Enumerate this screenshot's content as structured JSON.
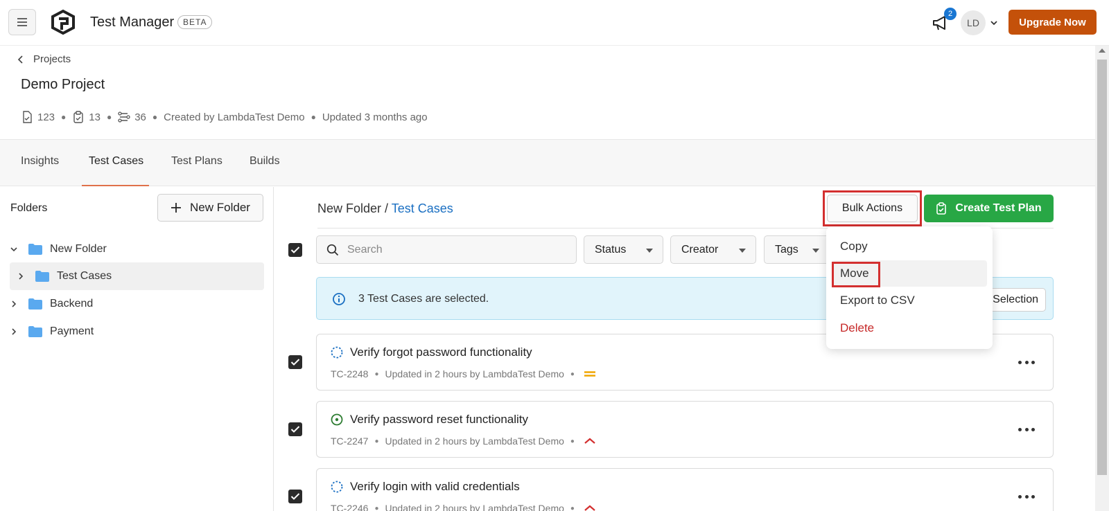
{
  "app": {
    "title": "Test Manager",
    "badge": "BETA",
    "upgrade_label": "Upgrade Now",
    "notifications_count": "2",
    "avatar_initials": "LD"
  },
  "project": {
    "back_label": "Projects",
    "title": "Demo Project",
    "meta": {
      "test_cases": "123",
      "test_plans": "13",
      "builds": "36",
      "created_by": "Created by LambdaTest Demo",
      "updated": "Updated 3 months ago"
    }
  },
  "tabs": [
    {
      "label": "Insights"
    },
    {
      "label": "Test Cases",
      "active": true
    },
    {
      "label": "Test Plans"
    },
    {
      "label": "Builds"
    }
  ],
  "sidebar": {
    "folders_label": "Folders",
    "new_folder_label": "New Folder",
    "tree": [
      {
        "label": "New Folder",
        "expanded": true
      },
      {
        "label": "Test Cases",
        "selected": true
      },
      {
        "label": "Backend"
      },
      {
        "label": "Payment"
      }
    ]
  },
  "main": {
    "breadcrumb": {
      "parent": "New Folder",
      "separator": " / ",
      "current": "Test Cases"
    },
    "bulk_actions_label": "Bulk Actions",
    "create_plan_label": "Create Test Plan",
    "search": {
      "placeholder": "Search",
      "value": ""
    },
    "filters": [
      {
        "label": "Status"
      },
      {
        "label": "Creator"
      },
      {
        "label": "Tags"
      }
    ],
    "selection_banner": {
      "text": "3 Test Cases are selected.",
      "clear_label": "Clear Selection"
    },
    "test_cases": [
      {
        "title": "Verify forgot password functionality",
        "id": "TC-2248",
        "updated": "Updated in 2 hours by LambdaTest Demo",
        "status": "in-progress",
        "priority": "medium"
      },
      {
        "title": "Verify password reset functionality",
        "id": "TC-2247",
        "updated": "Updated in 2 hours by LambdaTest Demo",
        "status": "active",
        "priority": "high"
      },
      {
        "title": "Verify login with valid credentials",
        "id": "TC-2246",
        "updated": "Updated in 2 hours by LambdaTest Demo",
        "status": "in-progress",
        "priority": "high"
      }
    ]
  },
  "bulk_menu": {
    "items": [
      {
        "label": "Copy"
      },
      {
        "label": "Move",
        "hover": true
      },
      {
        "label": "Export to CSV"
      },
      {
        "label": "Delete",
        "danger": true
      }
    ]
  },
  "colors": {
    "accent_orange": "#c4510a",
    "primary_green": "#28a745",
    "link_blue": "#1a6fc2",
    "highlight_red": "#d32f2f",
    "priority_medium": "#f0a500",
    "priority_high": "#d32f2f"
  },
  "icons": [
    "menu-icon",
    "logo-icon",
    "megaphone-icon",
    "chevron-down-icon",
    "chevron-left-icon",
    "test-case-icon",
    "test-plan-icon",
    "build-icon",
    "plus-icon",
    "folder-icon",
    "chevron-right-icon",
    "search-icon",
    "info-icon",
    "clipboard-icon",
    "check-icon",
    "status-circle-icon",
    "priority-medium-icon",
    "priority-high-icon",
    "more-options-icon"
  ]
}
